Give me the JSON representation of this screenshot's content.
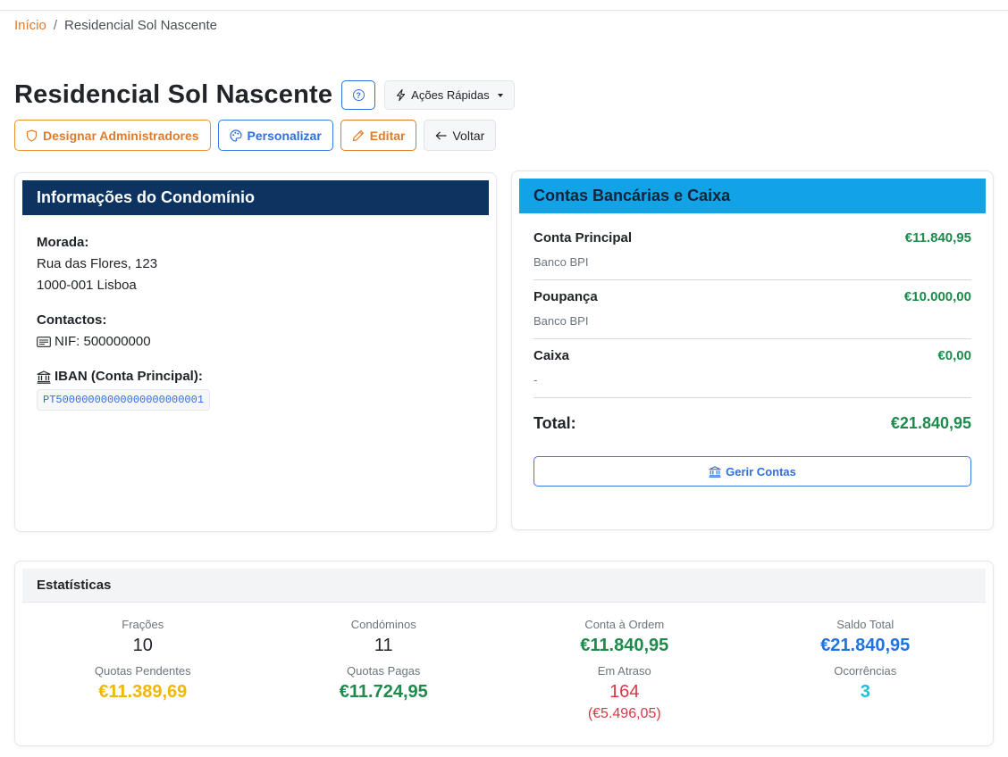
{
  "breadcrumb": {
    "home": "Início",
    "separator": "/",
    "current": "Residencial Sol Nascente"
  },
  "header": {
    "title": "Residencial Sol Nascente",
    "help_glyph": "?",
    "quick_actions_label": "Ações Rápidas"
  },
  "actions": {
    "designate_admins": "Designar Administradores",
    "customize": "Personalizar",
    "edit": "Editar",
    "back": "Voltar"
  },
  "info": {
    "title": "Informações do Condomínio",
    "address_label": "Morada:",
    "address_line1": "Rua das Flores, 123",
    "address_line2": "1000-001 Lisboa",
    "contacts_label": "Contactos:",
    "nif": "NIF: 500000000",
    "iban_label": "IBAN (Conta Principal):",
    "iban_value": "PT50000000000000000000001"
  },
  "bank": {
    "title": "Contas Bancárias e Caixa",
    "accounts": [
      {
        "name": "Conta Principal",
        "bank": "Banco BPI",
        "amount": "€11.840,95"
      },
      {
        "name": "Poupança",
        "bank": "Banco BPI",
        "amount": "€10.000,00"
      },
      {
        "name": "Caixa",
        "bank": "-",
        "amount": "€0,00"
      }
    ],
    "total_label": "Total:",
    "total_value": "€21.840,95",
    "manage_label": "Gerir Contas"
  },
  "stats": {
    "title": "Estatísticas",
    "items": [
      {
        "label": "Frações",
        "value": "10"
      },
      {
        "label": "Condóminos",
        "value": "11"
      },
      {
        "label": "Conta à Ordem",
        "value": "€11.840,95"
      },
      {
        "label": "Saldo Total",
        "value": "€21.840,95"
      },
      {
        "label": "Quotas Pendentes",
        "value": "€11.389,69"
      },
      {
        "label": "Quotas Pagas",
        "value": "€11.724,95"
      },
      {
        "label": "Em Atraso",
        "value": "164",
        "extra": "(€5.496,05)"
      },
      {
        "label": "Ocorrências",
        "value": "3"
      }
    ]
  },
  "colors": {
    "accent_orange": "#e07b2a",
    "accent_blue": "#2f6fdf",
    "info_header_bg": "#0d3460",
    "bank_header_bg": "#12a3e6",
    "money_green": "#1e8a4c",
    "alert_red": "#dc3545",
    "warning_yellow": "#f2b705",
    "info_cyan": "#1ec0d8"
  },
  "icons": {
    "help": "question-circle-icon",
    "quick_actions": "lightning-icon",
    "designate_admins": "shield-icon",
    "customize": "palette-icon",
    "edit": "pencil-icon",
    "back": "arrow-left-icon",
    "nif": "id-card-icon",
    "iban": "bank-icon",
    "manage_accounts": "bank-icon"
  }
}
